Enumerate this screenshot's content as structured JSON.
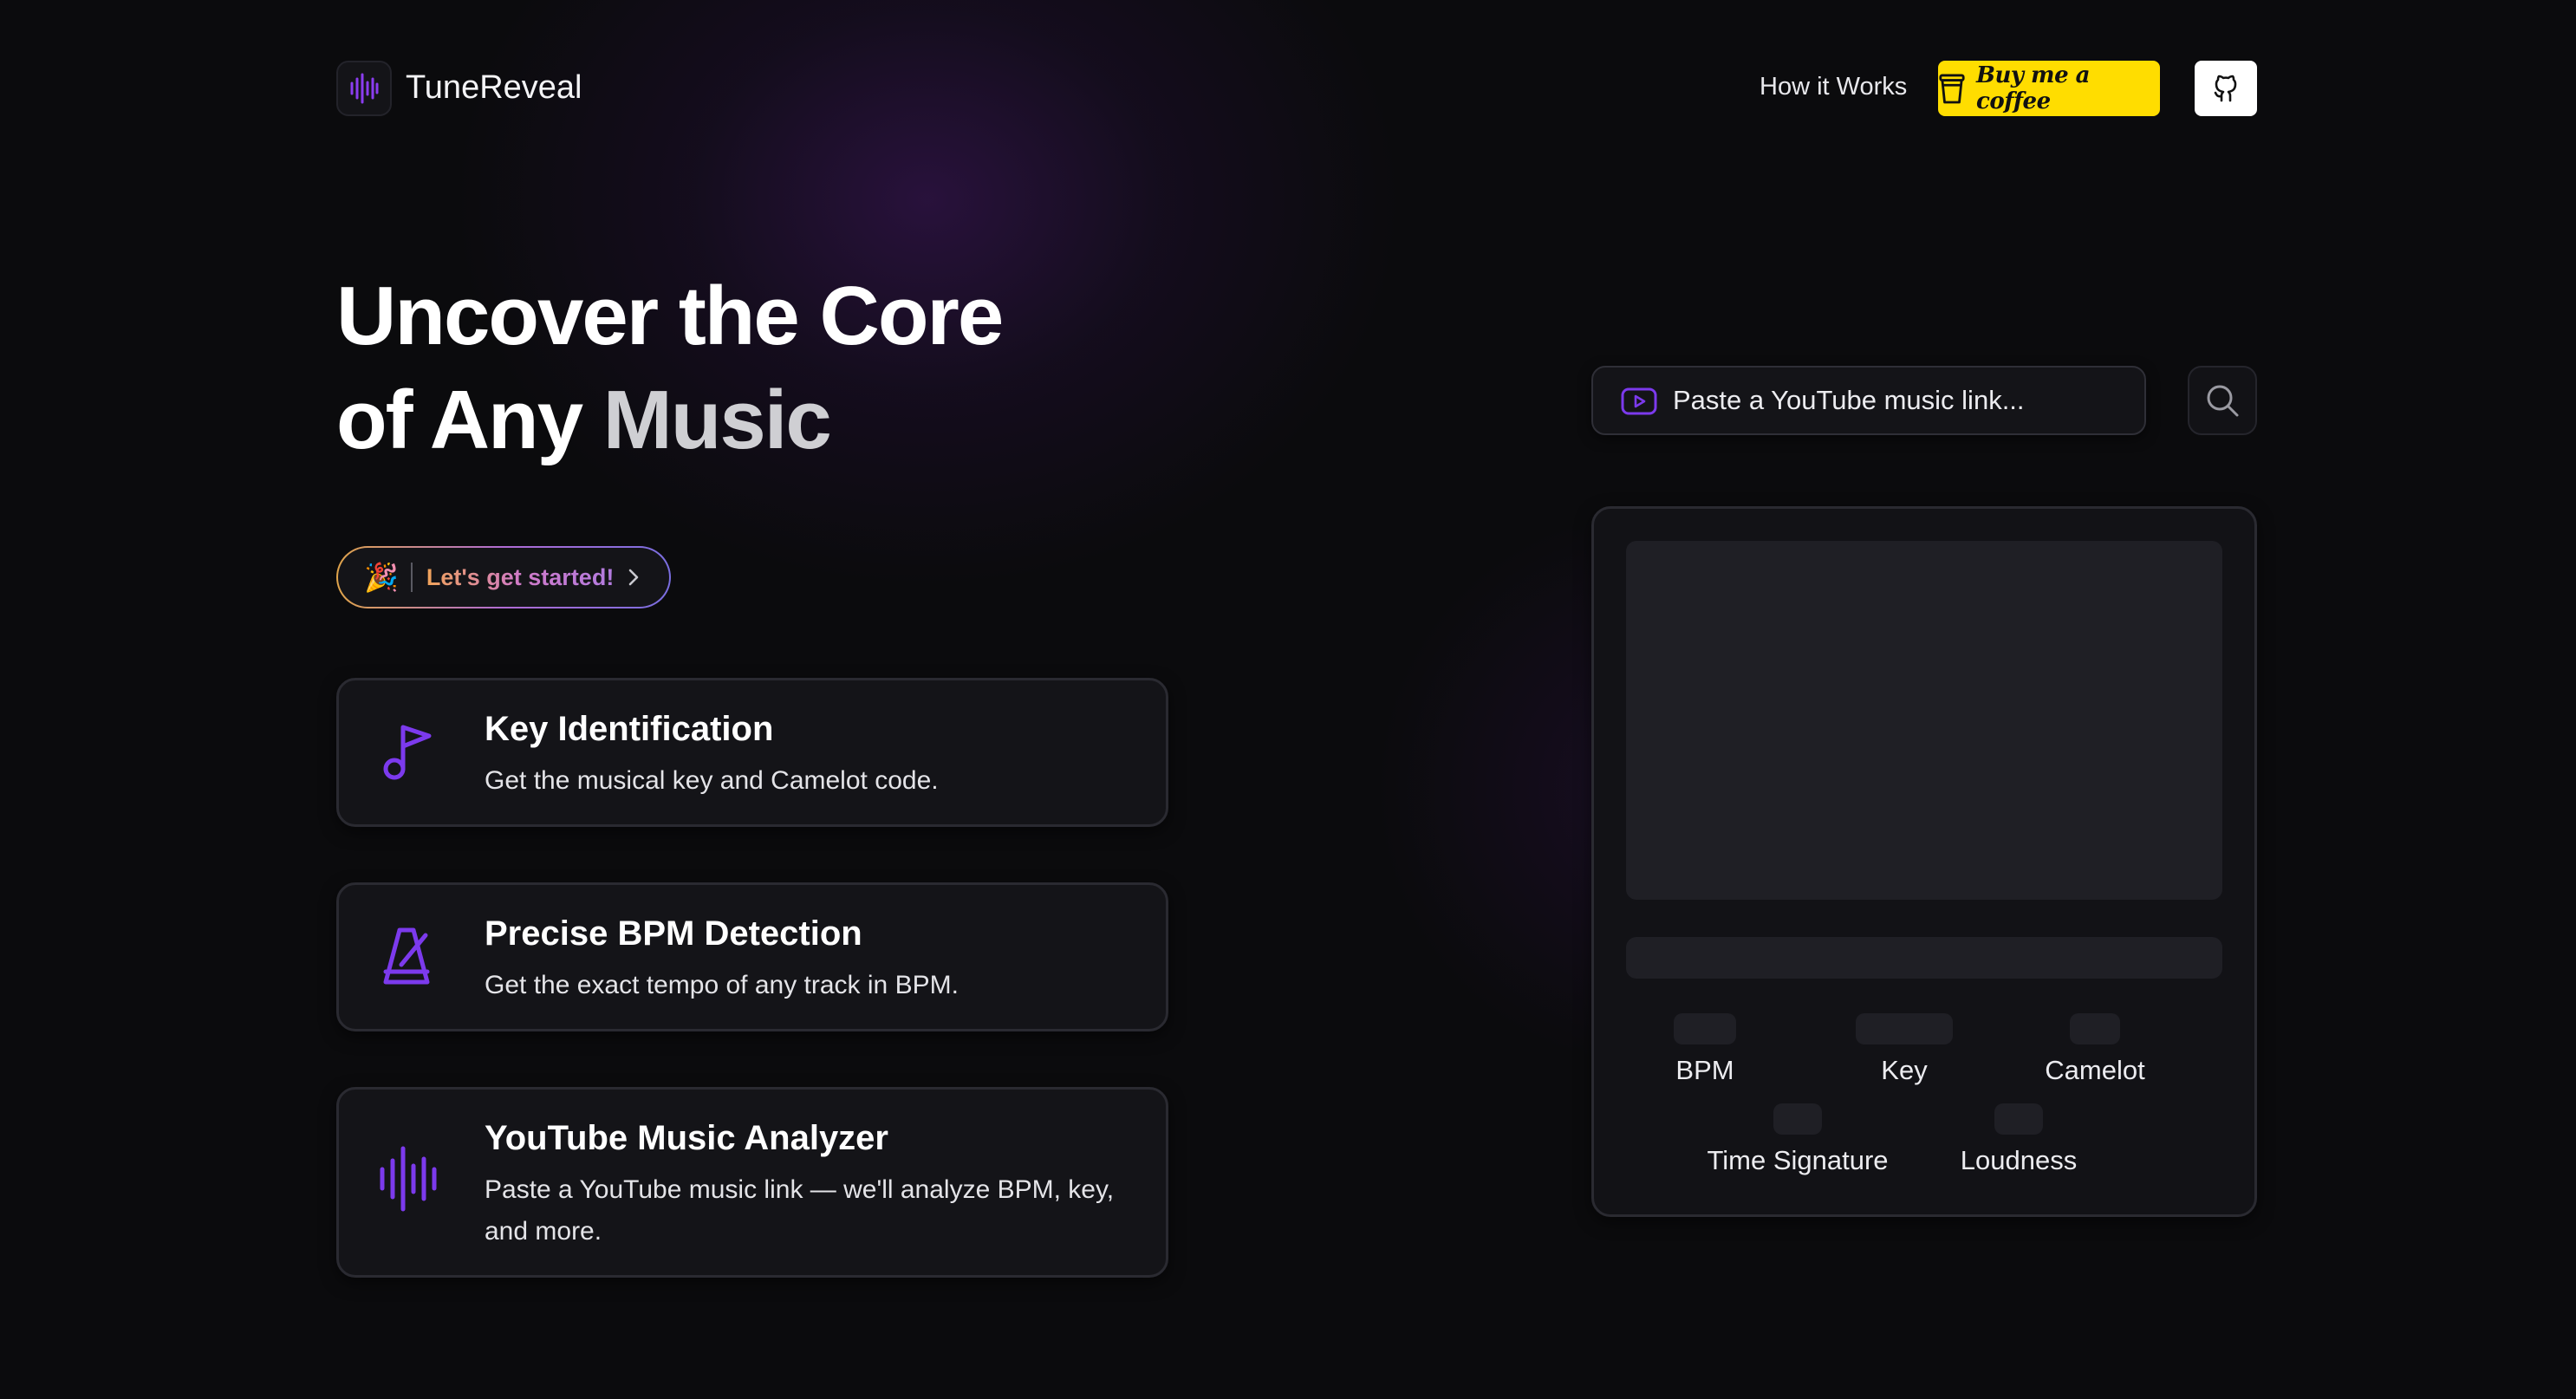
{
  "header": {
    "brand": "TuneReveal",
    "nav_how_it_works": "How it Works",
    "coffee_label": "Buy me a coffee"
  },
  "hero": {
    "line1": "Uncover the Core",
    "line2_a": "of Any ",
    "line2_b": "Music",
    "pill_emoji": "🎉",
    "pill_text": "Let's get started!"
  },
  "features": [
    {
      "title": "Key Identification",
      "description": "Get the musical key and Camelot code.",
      "icon": "music-note-icon"
    },
    {
      "title": "Precise BPM Detection",
      "description": "Get the exact tempo of any track in BPM.",
      "icon": "metronome-icon"
    },
    {
      "title": "YouTube Music Analyzer",
      "description": "Paste a YouTube music link — we'll analyze BPM, key, and more.",
      "icon": "audio-waveform-icon"
    }
  ],
  "search": {
    "placeholder": "Paste a YouTube music link...",
    "value": ""
  },
  "results": {
    "metrics": [
      "BPM",
      "Key",
      "Camelot",
      "Time Signature",
      "Loudness"
    ]
  },
  "colors": {
    "accent": "#7c3aed",
    "background": "#0b0b0d",
    "card": "#141418",
    "coffee_yellow": "#ffdd00"
  }
}
